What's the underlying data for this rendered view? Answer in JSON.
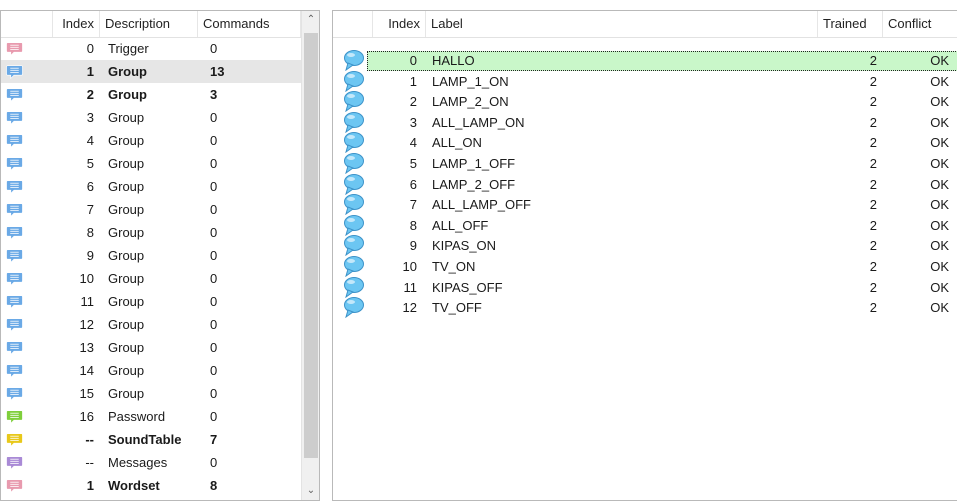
{
  "left_table": {
    "columns": [
      "Index",
      "Description",
      "Commands"
    ],
    "rows": [
      {
        "index": "0",
        "description": "Trigger",
        "commands": "0",
        "bold": false,
        "icon": "trigger-icon",
        "color": "#e89aae"
      },
      {
        "index": "1",
        "description": "Group",
        "commands": "13",
        "bold": true,
        "icon": "group-icon",
        "color": "#6aa9e6"
      },
      {
        "index": "2",
        "description": "Group",
        "commands": "3",
        "bold": true,
        "icon": "group-icon",
        "color": "#6aa9e6"
      },
      {
        "index": "3",
        "description": "Group",
        "commands": "0",
        "bold": false,
        "icon": "group-icon",
        "color": "#6aa9e6"
      },
      {
        "index": "4",
        "description": "Group",
        "commands": "0",
        "bold": false,
        "icon": "group-icon",
        "color": "#6aa9e6"
      },
      {
        "index": "5",
        "description": "Group",
        "commands": "0",
        "bold": false,
        "icon": "group-icon",
        "color": "#6aa9e6"
      },
      {
        "index": "6",
        "description": "Group",
        "commands": "0",
        "bold": false,
        "icon": "group-icon",
        "color": "#6aa9e6"
      },
      {
        "index": "7",
        "description": "Group",
        "commands": "0",
        "bold": false,
        "icon": "group-icon",
        "color": "#6aa9e6"
      },
      {
        "index": "8",
        "description": "Group",
        "commands": "0",
        "bold": false,
        "icon": "group-icon",
        "color": "#6aa9e6"
      },
      {
        "index": "9",
        "description": "Group",
        "commands": "0",
        "bold": false,
        "icon": "group-icon",
        "color": "#6aa9e6"
      },
      {
        "index": "10",
        "description": "Group",
        "commands": "0",
        "bold": false,
        "icon": "group-icon",
        "color": "#6aa9e6"
      },
      {
        "index": "11",
        "description": "Group",
        "commands": "0",
        "bold": false,
        "icon": "group-icon",
        "color": "#6aa9e6"
      },
      {
        "index": "12",
        "description": "Group",
        "commands": "0",
        "bold": false,
        "icon": "group-icon",
        "color": "#6aa9e6"
      },
      {
        "index": "13",
        "description": "Group",
        "commands": "0",
        "bold": false,
        "icon": "group-icon",
        "color": "#6aa9e6"
      },
      {
        "index": "14",
        "description": "Group",
        "commands": "0",
        "bold": false,
        "icon": "group-icon",
        "color": "#6aa9e6"
      },
      {
        "index": "15",
        "description": "Group",
        "commands": "0",
        "bold": false,
        "icon": "group-icon",
        "color": "#6aa9e6"
      },
      {
        "index": "16",
        "description": "Password",
        "commands": "0",
        "bold": false,
        "icon": "password-icon",
        "color": "#7fcf3c"
      },
      {
        "index": "--",
        "description": "SoundTable",
        "commands": "7",
        "bold": true,
        "icon": "soundtable-icon",
        "color": "#e8c81a"
      },
      {
        "index": "--",
        "description": "Messages",
        "commands": "0",
        "bold": false,
        "icon": "messages-icon",
        "color": "#a98ad6"
      },
      {
        "index": "1",
        "description": "Wordset",
        "commands": "8",
        "bold": true,
        "icon": "wordset-icon",
        "color": "#e89aae"
      }
    ],
    "scroll_up_symbol": "⌃",
    "scroll_down_symbol": "⌄"
  },
  "right_table": {
    "columns": [
      "Index",
      "Label",
      "Trained",
      "Conflict"
    ],
    "rows": [
      {
        "index": "0",
        "label": "HALLO",
        "trained": "2",
        "conflict": "OK"
      },
      {
        "index": "1",
        "label": "LAMP_1_ON",
        "trained": "2",
        "conflict": "OK"
      },
      {
        "index": "2",
        "label": "LAMP_2_ON",
        "trained": "2",
        "conflict": "OK"
      },
      {
        "index": "3",
        "label": "ALL_LAMP_ON",
        "trained": "2",
        "conflict": "OK"
      },
      {
        "index": "4",
        "label": "ALL_ON",
        "trained": "2",
        "conflict": "OK"
      },
      {
        "index": "5",
        "label": "LAMP_1_OFF",
        "trained": "2",
        "conflict": "OK"
      },
      {
        "index": "6",
        "label": "LAMP_2_OFF",
        "trained": "2",
        "conflict": "OK"
      },
      {
        "index": "7",
        "label": "ALL_LAMP_OFF",
        "trained": "2",
        "conflict": "OK"
      },
      {
        "index": "8",
        "label": "ALL_OFF",
        "trained": "2",
        "conflict": "OK"
      },
      {
        "index": "9",
        "label": "KIPAS_ON",
        "trained": "2",
        "conflict": "OK"
      },
      {
        "index": "10",
        "label": "TV_ON",
        "trained": "2",
        "conflict": "OK"
      },
      {
        "index": "11",
        "label": "KIPAS_OFF",
        "trained": "2",
        "conflict": "OK"
      },
      {
        "index": "12",
        "label": "TV_OFF",
        "trained": "2",
        "conflict": "OK"
      }
    ],
    "selected_index": 0,
    "icon": "speech-bubble-icon",
    "icon_color": "#6cc6f2"
  },
  "colors": {
    "selected_left": "#e6e6e6",
    "selected_right": "#c9f7c9"
  }
}
